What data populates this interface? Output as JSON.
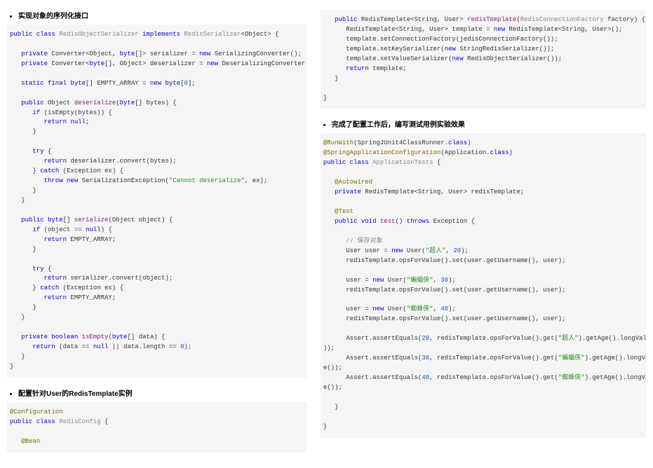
{
  "left": {
    "bullet1": "实现对象的序列化接口",
    "bullet2": "配置针对User的RedisTemplate实例",
    "code1": {
      "l01_a": "public class ",
      "l01_b": "RedisObjectSerializer ",
      "l01_c": "implements ",
      "l01_d": "RedisSerializer",
      "l01_e": "<Object> {",
      "l02_a": "   private ",
      "l02_b": "Converter<Object, ",
      "l02_c": "byte",
      "l02_d": "[]> serializer = ",
      "l02_e": "new ",
      "l02_f": "SerializingConverter();",
      "l03_a": "   private ",
      "l03_b": "Converter<",
      "l03_c": "byte",
      "l03_d": "[], Object> deserializer = ",
      "l03_e": "new ",
      "l03_f": "DeserializingConverter();",
      "l04_a": "   static final byte",
      "l04_b": "[] EMPTY_ARRAY = ",
      "l04_c": "new byte",
      "l04_d": "[",
      "l04_e": "0",
      "l04_f": "];",
      "l05_a": "   public ",
      "l05_b": "Object ",
      "l05_c": "deserialize",
      "l05_d": "(",
      "l05_e": "byte",
      "l05_f": "[] bytes) {",
      "l06_a": "      if ",
      "l06_b": "(isEmpty(bytes)) {",
      "l07_a": "         return null",
      "l07_b": ";",
      "l08": "      }",
      "l09_a": "      try ",
      "l09_b": "{",
      "l10_a": "         return ",
      "l10_b": "deserializer.convert(bytes);",
      "l11_a": "      } ",
      "l11_b": "catch ",
      "l11_c": "(Exception ex) {",
      "l12_a": "         throw new ",
      "l12_b": "SerializationException(",
      "l12_c": "\"Cannot deserialize\"",
      "l12_d": ", ex);",
      "l13": "      }",
      "l14": "   }",
      "l15_a": "   public byte",
      "l15_b": "[] ",
      "l15_c": "serialize",
      "l15_d": "(Object object) {",
      "l16_a": "      if ",
      "l16_b": "(object == ",
      "l16_c": "null",
      "l16_d": ") {",
      "l17_a": "         return ",
      "l17_b": "EMPTY_ARRAY;",
      "l18": "      }",
      "l19_a": "      try ",
      "l19_b": "{",
      "l20_a": "         return ",
      "l20_b": "serializer.convert(object);",
      "l21_a": "      } ",
      "l21_b": "catch ",
      "l21_c": "(Exception ex) {",
      "l22_a": "         return ",
      "l22_b": "EMPTY_ARRAY;",
      "l23": "      }",
      "l24": "   }",
      "l25_a": "   private boolean ",
      "l25_b": "isEmpty",
      "l25_c": "(",
      "l25_d": "byte",
      "l25_e": "[] data) {",
      "l26_a": "      return ",
      "l26_b": "(data == ",
      "l26_c": "null ",
      "l26_d": "|| data.length == ",
      "l26_e": "0",
      "l26_f": ");",
      "l27": "   }",
      "l28": "}"
    },
    "code2": {
      "l01": "@Configuration",
      "l02_a": "public class ",
      "l02_b": "RedisConfig ",
      "l02_c": "{",
      "l03": "   @Bean"
    }
  },
  "right": {
    "bullet1": "完成了配置工作后，编写测试用例实验效果",
    "code1": {
      "l01_a": "   public ",
      "l01_b": "RedisTemplate<String, User> ",
      "l01_c": "redisTemplate",
      "l01_d": "(",
      "l01_e": "RedisConnectionFactory ",
      "l01_f": "factory) {",
      "l02_a": "      RedisTemplate<String, User> template = ",
      "l02_b": "new ",
      "l02_c": "RedisTemplate<String, User>();",
      "l03": "      template.setConnectionFactory(jedisConnectionFactory());",
      "l04_a": "      template.setKeySerializer(",
      "l04_b": "new ",
      "l04_c": "StringRedisSerializer());",
      "l05_a": "      template.setValueSerializer(",
      "l05_b": "new ",
      "l05_c": "RedisObjectSerializer());",
      "l06_a": "      return ",
      "l06_b": "template;",
      "l07": "   }",
      "l08": "}"
    },
    "code2": {
      "l01_a": "@RunWith",
      "l01_b": "(SpringJUnit4ClassRunner.",
      "l01_c": "class",
      "l01_d": ")",
      "l02_a": "@SpringApplicationConfiguration",
      "l02_b": "(Application.",
      "l02_c": "class",
      "l02_d": ")",
      "l03_a": "public class ",
      "l03_b": "ApplicationTests ",
      "l03_c": "{",
      "l04": "   @Autowired",
      "l05_a": "   private ",
      "l05_b": "RedisTemplate<String, User> redisTemplate;",
      "l06": "   @Test",
      "l07_a": "   public void ",
      "l07_b": "test",
      "l07_c": "() ",
      "l07_d": "throws ",
      "l07_e": "Exception {",
      "l08": "      // 保存对象",
      "l09_a": "      User user = ",
      "l09_b": "new ",
      "l09_c": "User(",
      "l09_d": "\"超人\"",
      "l09_e": ", ",
      "l09_f": "20",
      "l09_g": ");",
      "l10": "      redisTemplate.opsForValue().set(user.getUsername(), user);",
      "l11_a": "      user = ",
      "l11_b": "new ",
      "l11_c": "User(",
      "l11_d": "\"蝙蝠侠\"",
      "l11_e": ", ",
      "l11_f": "30",
      "l11_g": ");",
      "l12": "      redisTemplate.opsForValue().set(user.getUsername(), user);",
      "l13_a": "      user = ",
      "l13_b": "new ",
      "l13_c": "User(",
      "l13_d": "\"蜘蛛侠\"",
      "l13_e": ", ",
      "l13_f": "40",
      "l13_g": ");",
      "l14": "      redisTemplate.opsForValue().set(user.getUsername(), user);",
      "l15_a": "      Assert.assertEquals(",
      "l15_b": "20",
      "l15_c": ", redisTemplate.opsForValue().get(",
      "l15_d": "\"超人\"",
      "l15_e": ").getAge().longValue(",
      "l16": "));",
      "l17_a": "      Assert.assertEquals(",
      "l17_b": "30",
      "l17_c": ", redisTemplate.opsForValue().get(",
      "l17_d": "\"蝙蝠侠\"",
      "l17_e": ").getAge().longValu",
      "l18": "e());",
      "l19_a": "      Assert.assertEquals(",
      "l19_b": "40",
      "l19_c": ", redisTemplate.opsForValue().get(",
      "l19_d": "\"蜘蛛侠\"",
      "l19_e": ").getAge().longValu",
      "l20": "e());",
      "l21": "   }",
      "l22": "}"
    }
  }
}
